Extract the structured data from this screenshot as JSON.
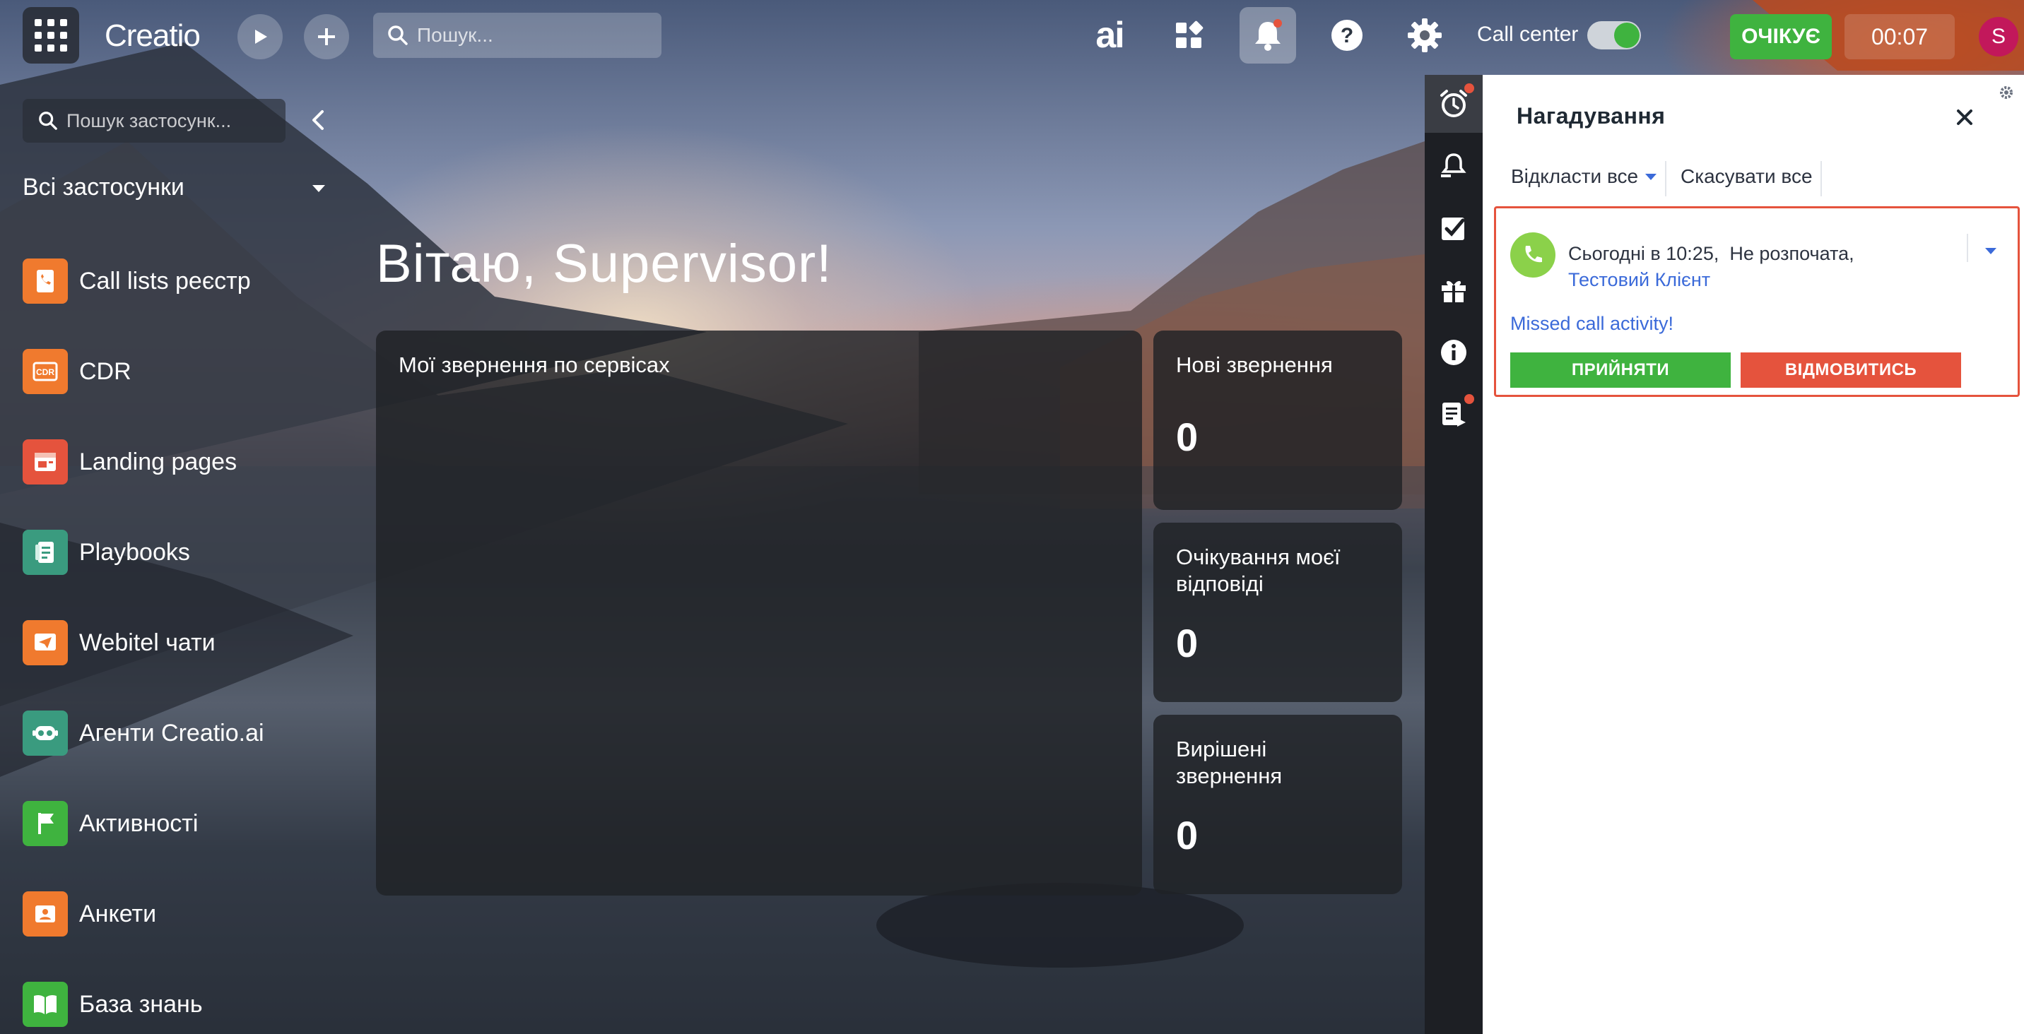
{
  "topbar": {
    "logo": "Creatio",
    "search_placeholder": "Пошук...",
    "ai_label": "ai",
    "call_center_label": "Call center",
    "status_label": "ОЧІКУЄ",
    "timer": "00:07",
    "avatar_initial": "S"
  },
  "sidebar": {
    "search_placeholder": "Пошук застосунк...",
    "section_label": "Всі застосунки",
    "items": [
      {
        "label": "Call lists реєстр",
        "icon": "phone-list-icon",
        "color": "#f07a2e"
      },
      {
        "label": "CDR",
        "icon": "cdr-icon",
        "color": "#f07a2e"
      },
      {
        "label": "Landing pages",
        "icon": "landing-page-icon",
        "color": "#e5533d"
      },
      {
        "label": "Playbooks",
        "icon": "playbook-icon",
        "color": "#3a9b7f"
      },
      {
        "label": "Webitel чати",
        "icon": "send-icon",
        "color": "#f07a2e"
      },
      {
        "label": "Агенти Creatio.ai",
        "icon": "robot-icon",
        "color": "#3a9b7f"
      },
      {
        "label": "Активності",
        "icon": "flag-icon",
        "color": "#3fb33f"
      },
      {
        "label": "Анкети",
        "icon": "person-card-icon",
        "color": "#f07a2e"
      },
      {
        "label": "База знань",
        "icon": "book-icon",
        "color": "#3fb33f"
      }
    ]
  },
  "main": {
    "greeting": "Вітаю, Supervisor!",
    "cards": {
      "services": {
        "title": "Мої звернення по сервісах"
      },
      "new": {
        "title": "Нові звернення",
        "value": "0"
      },
      "waiting": {
        "title": "Очікування моєї відповіді",
        "value": "0"
      },
      "resolved": {
        "title": "Вирішені звернення",
        "value": "0"
      }
    }
  },
  "panel": {
    "title": "Нагадування",
    "postpone_all": "Відкласти все",
    "cancel_all": "Скасувати все",
    "reminder": {
      "time_text": "Сьогодні в 10:25,",
      "status_text": "Не розпочата,",
      "contact": "Тестовий Клієнт",
      "subject": "Missed call activity!",
      "accept_label": "ПРИЙНЯТИ",
      "decline_label": "ВІДМОВИТИСЬ"
    }
  },
  "colors": {
    "accent_green": "#3fb33f",
    "accent_red": "#e5533d",
    "link_blue": "#3b6ad9"
  }
}
